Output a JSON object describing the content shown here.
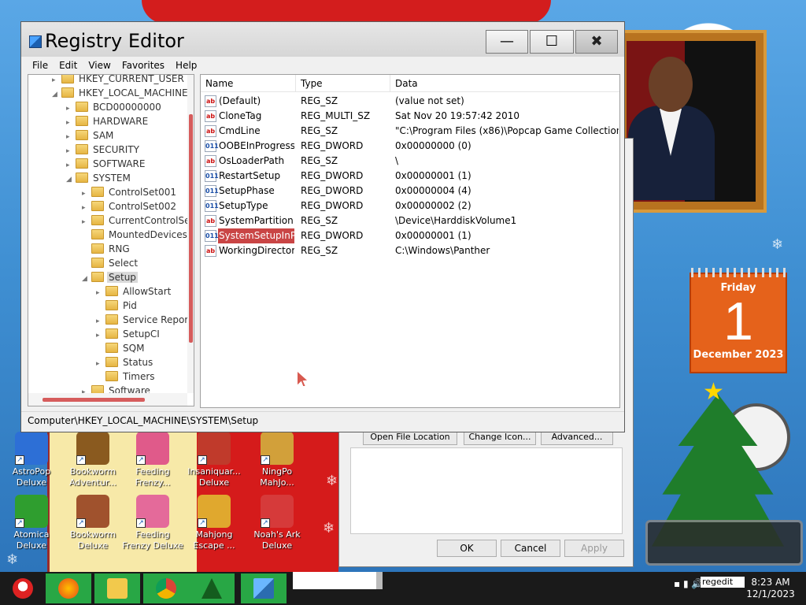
{
  "window": {
    "title": "Registry Editor",
    "minimize": "—",
    "maximize": "☐",
    "close": "✖"
  },
  "menu": [
    "File",
    "Edit",
    "View",
    "Favorites",
    "Help"
  ],
  "tree": [
    {
      "label": "HKEY_CURRENT_USER",
      "level": 1,
      "exp": "▸"
    },
    {
      "label": "HKEY_LOCAL_MACHINE",
      "level": 1,
      "exp": "◢"
    },
    {
      "label": "BCD00000000",
      "level": 2,
      "exp": "▸"
    },
    {
      "label": "HARDWARE",
      "level": 2,
      "exp": "▸"
    },
    {
      "label": "SAM",
      "level": 2,
      "exp": "▸"
    },
    {
      "label": "SECURITY",
      "level": 2,
      "exp": "▸"
    },
    {
      "label": "SOFTWARE",
      "level": 2,
      "exp": "▸"
    },
    {
      "label": "SYSTEM",
      "level": 2,
      "exp": "◢"
    },
    {
      "label": "ControlSet001",
      "level": 3,
      "exp": "▸"
    },
    {
      "label": "ControlSet002",
      "level": 3,
      "exp": "▸"
    },
    {
      "label": "CurrentControlSet",
      "level": 3,
      "exp": "▸"
    },
    {
      "label": "MountedDevices",
      "level": 3,
      "exp": ""
    },
    {
      "label": "RNG",
      "level": 3,
      "exp": ""
    },
    {
      "label": "Select",
      "level": 3,
      "exp": ""
    },
    {
      "label": "Setup",
      "level": 3,
      "exp": "◢",
      "selected": true
    },
    {
      "label": "AllowStart",
      "level": 4,
      "exp": "▸"
    },
    {
      "label": "Pid",
      "level": 4,
      "exp": ""
    },
    {
      "label": "Service Report",
      "level": 4,
      "exp": "▸"
    },
    {
      "label": "SetupCI",
      "level": 4,
      "exp": "▸"
    },
    {
      "label": "SQM",
      "level": 4,
      "exp": ""
    },
    {
      "label": "Status",
      "level": 4,
      "exp": "▸"
    },
    {
      "label": "Timers",
      "level": 4,
      "exp": ""
    },
    {
      "label": "Software",
      "level": 3,
      "exp": "▸"
    }
  ],
  "columns": {
    "name": "Name",
    "type": "Type",
    "data": "Data"
  },
  "values": [
    {
      "icon": "ab",
      "name": "(Default)",
      "type": "REG_SZ",
      "data": "(value not set)"
    },
    {
      "icon": "ab",
      "name": "CloneTag",
      "type": "REG_MULTI_SZ",
      "data": "Sat Nov 20 19:57:42 2010"
    },
    {
      "icon": "ab",
      "name": "CmdLine",
      "type": "REG_SZ",
      "data": "\"C:\\Program Files (x86)\\Popcap Game Collection\\..."
    },
    {
      "icon": "011",
      "name": "OOBEInProgress",
      "type": "REG_DWORD",
      "data": "0x00000000 (0)"
    },
    {
      "icon": "ab",
      "name": "OsLoaderPath",
      "type": "REG_SZ",
      "data": "\\"
    },
    {
      "icon": "011",
      "name": "RestartSetup",
      "type": "REG_DWORD",
      "data": "0x00000001 (1)"
    },
    {
      "icon": "011",
      "name": "SetupPhase",
      "type": "REG_DWORD",
      "data": "0x00000004 (4)"
    },
    {
      "icon": "011",
      "name": "SetupType",
      "type": "REG_DWORD",
      "data": "0x00000002 (2)"
    },
    {
      "icon": "ab",
      "name": "SystemPartition",
      "type": "REG_SZ",
      "data": "\\Device\\HarddiskVolume1"
    },
    {
      "icon": "011",
      "name": "SystemSetupInP...",
      "type": "REG_DWORD",
      "data": "0x00000001 (1)",
      "selected": true
    },
    {
      "icon": "ab",
      "name": "WorkingDirectory",
      "type": "REG_SZ",
      "data": "C:\\Windows\\Panther"
    }
  ],
  "status_path": "Computer\\HKEY_LOCAL_MACHINE\\SYSTEM\\Setup",
  "props_dialog": {
    "open_file_location": "Open File Location",
    "change_icon": "Change Icon...",
    "advanced": "Advanced...",
    "ok": "OK",
    "cancel": "Cancel",
    "apply": "Apply"
  },
  "calendar": {
    "weekday": "Friday",
    "day": "1",
    "month": "December 2023"
  },
  "desktop_icons": [
    {
      "label": "AstroPop Deluxe",
      "color": "#2d6fd6"
    },
    {
      "label": "Bookworm Adventur...",
      "color": "#8a5a1f"
    },
    {
      "label": "Feeding Frenzy...",
      "color": "#e05a8a"
    },
    {
      "label": "Insaniquar... Deluxe",
      "color": "#c03a2b"
    },
    {
      "label": "NingPo MahJo...",
      "color": "#d2a03a"
    },
    {
      "label": "Atomica Deluxe",
      "color": "#2f9e2f"
    },
    {
      "label": "Bookworm Deluxe",
      "color": "#a0522d"
    },
    {
      "label": "Feeding Frenzy Deluxe",
      "color": "#e46a9a"
    },
    {
      "label": "Mahjong Escape ...",
      "color": "#e0a82e"
    },
    {
      "label": "Noah's Ark Deluxe",
      "color": "#d63a3a"
    }
  ],
  "taskbar": {
    "search_text": "regedit",
    "time": "8:23 AM",
    "date": "12/1/2023"
  },
  "colors": {
    "selection": "#c94545",
    "taskbar_accent": "#28a745",
    "calendar": "#e5621b"
  }
}
